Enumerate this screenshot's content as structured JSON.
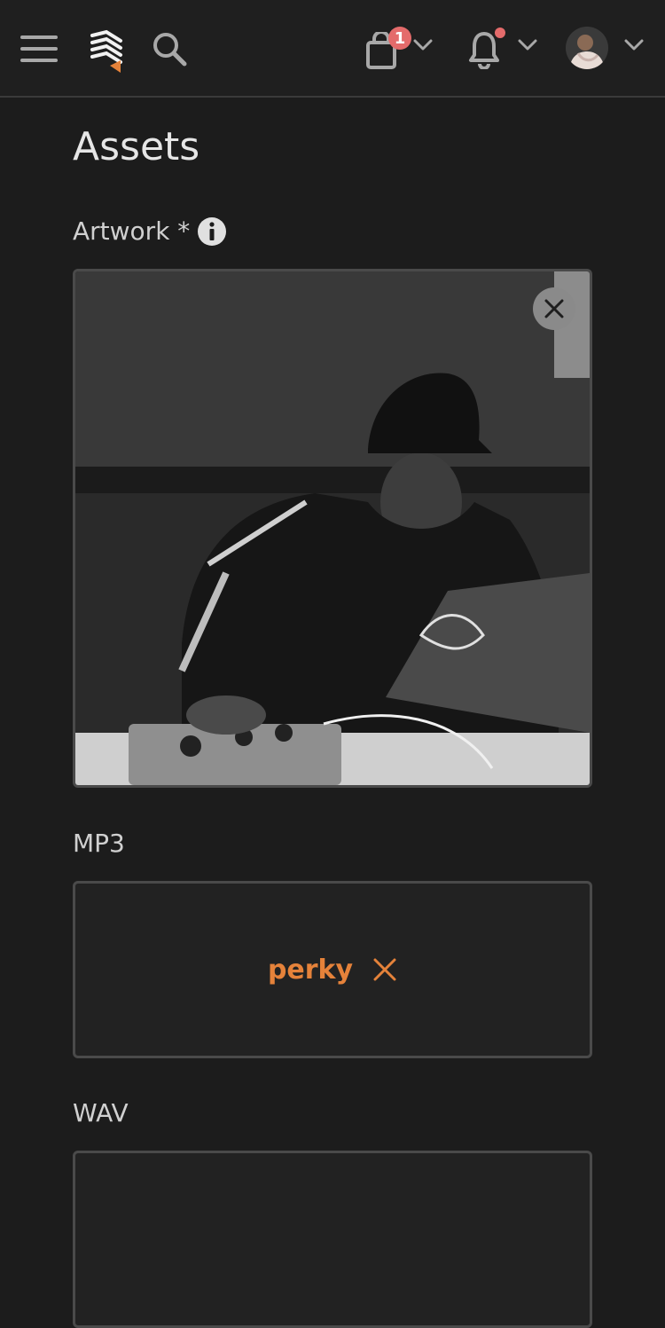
{
  "header": {
    "cart": {
      "badge_count": "1"
    },
    "notifications": {
      "has_unread": true
    },
    "colors": {
      "badge": "#e46b6b",
      "accent": "#e5823a"
    }
  },
  "page": {
    "title": "Assets"
  },
  "artwork": {
    "label": "Artwork *"
  },
  "mp3": {
    "label": "MP3",
    "file_name": "perky"
  },
  "wav": {
    "label": "WAV"
  }
}
